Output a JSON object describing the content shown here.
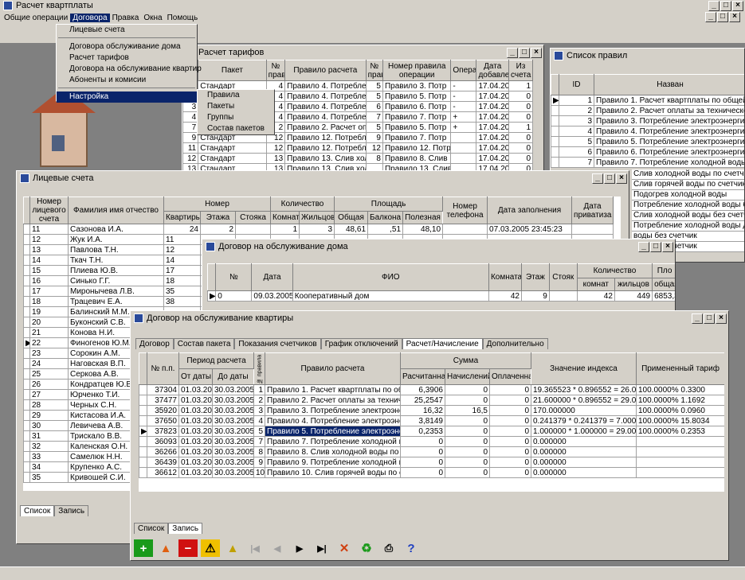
{
  "app": {
    "title": "Расчет квартплаты"
  },
  "menu": [
    "Общие операции",
    "Договора",
    "Правка",
    "Окна",
    "Помощь"
  ],
  "dropdown": {
    "items": [
      "Лицевые счета",
      "Договора обслуживание дома",
      "Расчет тарифов",
      "Договора на обслуживание квартир",
      "Абоненты и комисии",
      "Настройка"
    ],
    "sub": [
      "Правила",
      "Пакеты",
      "Группы",
      "Состав пакетов"
    ]
  },
  "tarif": {
    "title": "Расчет тарифов",
    "headers": [
      "№",
      "Пакет",
      "№ правила",
      "Правило расчета",
      "№ правила",
      "Номер правила операции",
      "Операция",
      "Дата добавления",
      "Из счета"
    ],
    "rows": [
      [
        "1",
        "Стандарт",
        "4",
        "Правило 4. Потребление",
        "5",
        "Правило 3. Потр",
        "-",
        "17.04.200",
        "1"
      ],
      [
        "2",
        "Стандарт",
        "4",
        "Правило 4. Потребление",
        "5",
        "Правило 5. Потр",
        "-",
        "17.04.200",
        "0"
      ],
      [
        "3",
        "Стандарт",
        "4",
        "Правило 4. Потребление",
        "6",
        "Правило 6. Потр",
        "-",
        "17.04.200",
        "0"
      ],
      [
        "4",
        "Стандарт",
        "4",
        "Правило 4. Потребление",
        "7",
        "Правило 7. Потр",
        "+",
        "17.04.200",
        "0"
      ],
      [
        "7",
        "Стандарт",
        "2",
        "Правило 2. Расчет опла",
        "5",
        "Правило 5. Потр",
        "+",
        "17.04.200",
        "1"
      ],
      [
        "9",
        "Стандарт",
        "12",
        "Правило 12. Потребле",
        "9",
        "Правило 7. Потр",
        "",
        "17.04.200",
        "0"
      ],
      [
        "11",
        "Стандарт",
        "12",
        "Правило 12. Потребле",
        "12",
        "Правило 12. Потр",
        "",
        "17.04.200",
        "0"
      ],
      [
        "12",
        "Стандарт",
        "13",
        "Правило 13. Слив холод",
        "8",
        "Правило 8. Слив",
        "",
        "17.04.200",
        "0"
      ],
      [
        "13",
        "Стандарт",
        "13",
        "Правило 13. Слив холо",
        "",
        "Правило 13. Слив",
        "",
        "17.04.200",
        "0"
      ]
    ]
  },
  "rules": {
    "title": "Список правил",
    "h_id": "ID",
    "h_name": "Назван",
    "rows": [
      [
        "1",
        "Правило 1. Расчет квартплаты по общей площ"
      ],
      [
        "2",
        "Правило 2. Расчет оплаты за техническое обс"
      ],
      [
        "3",
        "Правило 3. Потребление электроэнергии по с"
      ],
      [
        "4",
        "Правило 4. Потребление электроэнергии без"
      ],
      [
        "5",
        "Правило 5. Потребление электроэнергии лиф"
      ],
      [
        "6",
        "Правило 6. Потребление электроэнергии для"
      ],
      [
        "7",
        "Правило 7. Потребление холодной воды по сч"
      ]
    ],
    "extra": [
      "Слив холодной воды по счетчикам",
      "Слив горячей воды по счетчикам",
      "Подогрев холодной воды",
      "Потребление холодной воды без",
      "Слив холодной воды без счетчи",
      "Потребление холодной воды для",
      "воды без счетчик",
      "воды без счетчик"
    ]
  },
  "ls": {
    "title": "Лицевые счета",
    "h": {
      "num": "Номер лицевого счета",
      "fio": "Фамилия имя отчество",
      "nomer": "Номер",
      "kv": "Квартиры",
      "et": "Этажа",
      "st": "Стояка",
      "kol": "Количество",
      "kom": "Комнат",
      "zh": "Жильцов",
      "pl": "Площадь",
      "ob": "Общая",
      "bal": "Балкона",
      "pol": "Полезная",
      "tel": "Номер телефона",
      "dz": "Дата заполнения",
      "dp": "Дата приватиза"
    },
    "first": [
      "11",
      "Сазонова И.А.",
      "24",
      "2",
      "",
      "1",
      "3",
      "48,61",
      ",51",
      "48,10",
      "",
      "07.03.2005 23:45:23"
    ],
    "rows": [
      [
        "12",
        "Жук И.А.",
        "11"
      ],
      [
        "13",
        "Павлова Т.Н.",
        "12"
      ],
      [
        "14",
        "Ткач Т.Н.",
        "14"
      ],
      [
        "15",
        "Плиева Ю.В.",
        "17"
      ],
      [
        "16",
        "Синько Г.Г.",
        "18"
      ],
      [
        "17",
        "Миронычева Л.В.",
        "35"
      ],
      [
        "18",
        "Трацевич Е.А.",
        "38"
      ],
      [
        "19",
        "Балинский М.М.",
        ""
      ],
      [
        "20",
        "Буконский С.В.",
        ""
      ],
      [
        "21",
        "Конова Н.И.",
        ""
      ],
      [
        "22",
        "Финогенов Ю.М.",
        ""
      ],
      [
        "23",
        "Сорокин А.М.",
        ""
      ],
      [
        "24",
        "Наговская В.П.",
        ""
      ],
      [
        "25",
        "Серкова А.В.",
        ""
      ],
      [
        "26",
        "Кондратцев Ю.В.",
        ""
      ],
      [
        "27",
        "Юрченко Т.И.",
        ""
      ],
      [
        "28",
        "Черных С.Н.",
        ""
      ],
      [
        "29",
        "Кистасова И.А.",
        ""
      ],
      [
        "30",
        "Левичева А.В.",
        ""
      ],
      [
        "31",
        "Трискало В.В.",
        ""
      ],
      [
        "32",
        "Каленская О.Н.",
        ""
      ],
      [
        "33",
        "Самелюк Н.Н.",
        ""
      ],
      [
        "34",
        "Крупенко А.С.",
        ""
      ],
      [
        "35",
        "Кривошей С.И.",
        ""
      ]
    ],
    "tabs": [
      "Список",
      "Запись"
    ]
  },
  "dom": {
    "title": "Договор на обслуживание дома",
    "h": [
      "№",
      "Дата",
      "ФИО",
      "Комната",
      "Этаж",
      "Стояк",
      "Количество",
      "комнат",
      "жильцов",
      "Пло",
      "общая",
      "бал"
    ],
    "row": [
      "0",
      "09.03.2005",
      "Кооперативный дом",
      "42",
      "9",
      "",
      "42",
      "449",
      "6853,38",
      ""
    ]
  },
  "kv": {
    "title": "Договор на обслуживание квартиры",
    "tabs": [
      "Договор",
      "Состав пакета",
      "Показания счетчиков",
      "График отключений",
      "Расчет/Начисление",
      "Дополнительно"
    ],
    "h": {
      "np": "№ п.п.",
      "per": "Период расчета",
      "ot": "От даты",
      "do": "До даты",
      "npr": "№ правила",
      "pr": "Правило расчета",
      "sum": "Сумма",
      "ras": "Расчитанная",
      "nach": "Начислений",
      "opl": "Оплаченная",
      "zi": "Значение индекса",
      "tar": "Примененный тариф"
    },
    "rows": [
      [
        "37304",
        "01.03.2005",
        "30.03.2005",
        "1",
        "Правило 1. Расчет квартплаты по общей п...",
        "6,3906",
        "0",
        "0",
        "19.365523 * 0.896552 = 26.000000",
        "100.0000% 0.3300"
      ],
      [
        "37477",
        "01.03.2005",
        "30.03.2005",
        "2",
        "Правило 2. Расчет оплаты за техническое ...",
        "25,2547",
        "0",
        "0",
        "21.600000 * 0.896552 = 29.000000",
        "100.0000% 1.1692"
      ],
      [
        "35920",
        "01.03.2005",
        "30.03.2005",
        "3",
        "Правило 3. Потребление электроэнергии п...",
        "16,32",
        "16,5",
        "0",
        "170.000000",
        "100.0000% 0.0960"
      ],
      [
        "37650",
        "01.03.2005",
        "30.03.2005",
        "4",
        "Правило 4. Потребление электроэнергии б...",
        "3,8149",
        "0",
        "0",
        "0.241379 * 0.241379 = 7.000000",
        "100.0000% 15.8034"
      ],
      [
        "37823",
        "01.03.2005",
        "30.03.2005",
        "5",
        "Правило 5. Потребление электроэнергии д...",
        "0,2353",
        "0",
        "0",
        "1.000000 * 1.000000 = 29.000000",
        "100.0000% 0.2353"
      ],
      [
        "36093",
        "01.03.2005",
        "30.03.2005",
        "7",
        "Правило 7. Потребление холодной воды по...",
        "0",
        "0",
        "0",
        "0.000000",
        ""
      ],
      [
        "36266",
        "01.03.2005",
        "30.03.2005",
        "8",
        "Правило 8. Слив холодной воды по счетчик...",
        "0",
        "0",
        "0",
        "0.000000",
        ""
      ],
      [
        "36439",
        "01.03.2005",
        "30.03.2005",
        "9",
        "Правило 9. Потребление холодной воды б...",
        "0",
        "0",
        "0",
        "0.000000",
        ""
      ],
      [
        "36612",
        "01.03.2005",
        "30.03.2005",
        "10",
        "Правило 10. Слив горячей воды по счетчи...",
        "0",
        "0",
        "0",
        "0.000000",
        ""
      ]
    ],
    "btabs": [
      "Список",
      "Запись"
    ]
  }
}
